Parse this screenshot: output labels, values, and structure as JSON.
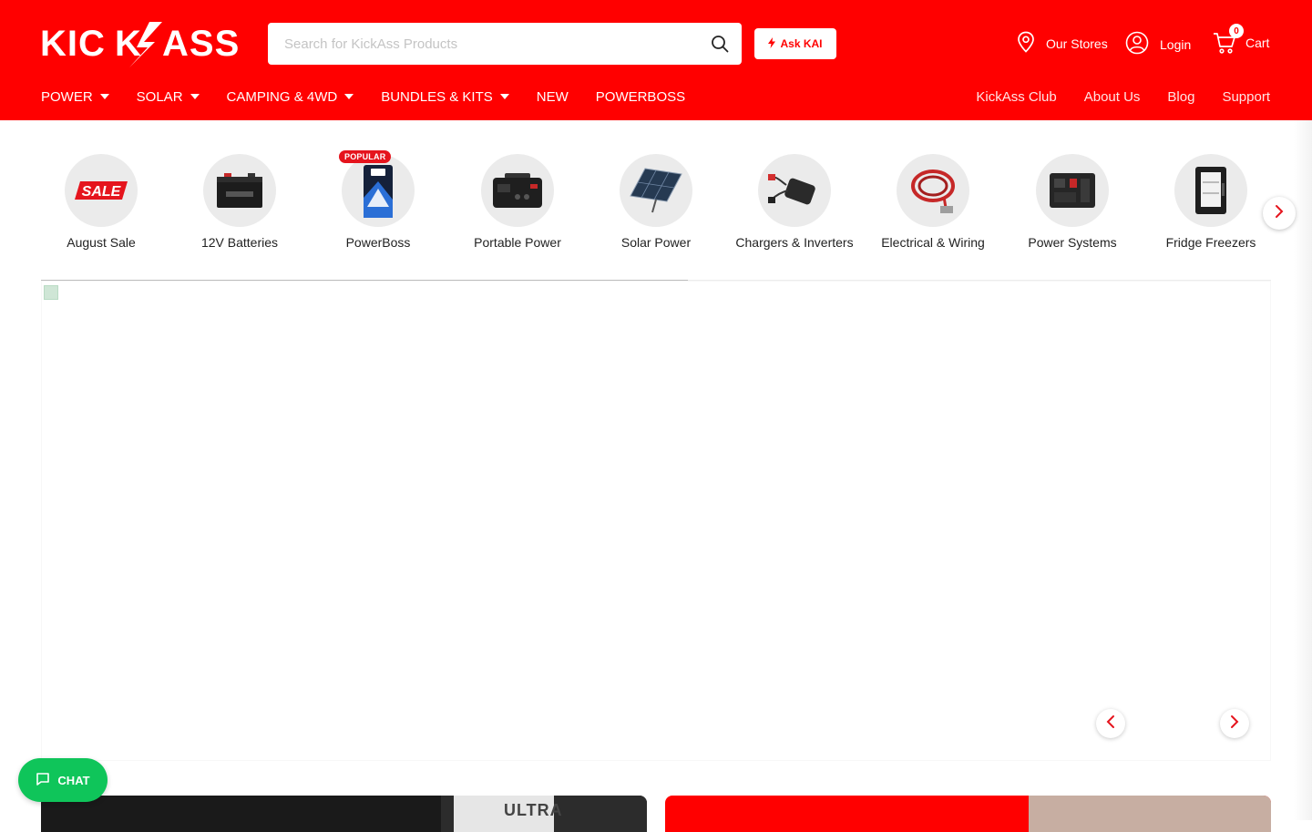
{
  "brand": {
    "name": "KICKASS",
    "accent": "#ff0000",
    "chat_color": "#0fc55a"
  },
  "search": {
    "placeholder": "Search for KickAss Products",
    "icon": "search-icon"
  },
  "ask_kai": {
    "label": "Ask KAI",
    "icon": "bolt-icon"
  },
  "utility": {
    "stores": {
      "label": "Our Stores",
      "icon": "location-pin-icon"
    },
    "login": {
      "label": "Login",
      "icon": "user-icon"
    },
    "cart": {
      "label": "Cart",
      "count": "0",
      "icon": "cart-icon"
    }
  },
  "nav_left": [
    {
      "label": "POWER",
      "dropdown": true
    },
    {
      "label": "SOLAR",
      "dropdown": true
    },
    {
      "label": "CAMPING & 4WD",
      "dropdown": true
    },
    {
      "label": "BUNDLES & KITS",
      "dropdown": true
    },
    {
      "label": "NEW",
      "dropdown": false
    },
    {
      "label": "POWERBOSS",
      "dropdown": false
    }
  ],
  "nav_right": [
    {
      "label": "KickAss Club"
    },
    {
      "label": "About Us"
    },
    {
      "label": "Blog"
    },
    {
      "label": "Support"
    }
  ],
  "categories": [
    {
      "label": "August Sale",
      "icon": "sale-tag-icon",
      "badge": ""
    },
    {
      "label": "12V Batteries",
      "icon": "battery-icon",
      "badge": ""
    },
    {
      "label": "PowerBoss",
      "icon": "powerboss-pack-icon",
      "badge": "POPULAR"
    },
    {
      "label": "Portable Power",
      "icon": "portable-power-station-icon",
      "badge": ""
    },
    {
      "label": "Solar Power",
      "icon": "solar-panel-icon",
      "badge": ""
    },
    {
      "label": "Chargers & Inverters",
      "icon": "charger-icon",
      "badge": ""
    },
    {
      "label": "Electrical & Wiring",
      "icon": "cable-coil-icon",
      "badge": ""
    },
    {
      "label": "Power Systems",
      "icon": "power-system-icon",
      "badge": ""
    },
    {
      "label": "Fridge Freezers",
      "icon": "fridge-icon",
      "badge": ""
    }
  ],
  "sale_badge_text": "SALE",
  "category_scroll_progress": 0.526,
  "promo_left_text": "ULTRA",
  "chat": {
    "label": "CHAT",
    "icon": "chat-bubble-icon"
  }
}
